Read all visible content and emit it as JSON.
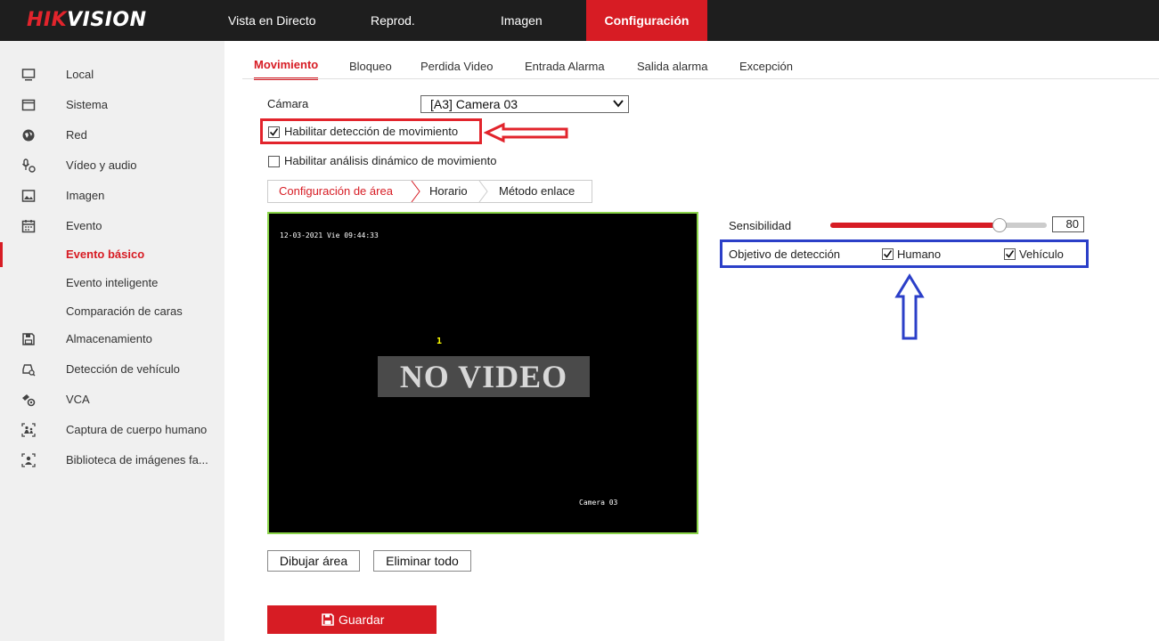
{
  "brand": {
    "logo_red": "HIK",
    "logo_white": "VISION",
    "accent": "#d71c24"
  },
  "topnav": [
    {
      "label": "Vista en Directo"
    },
    {
      "label": "Reprod."
    },
    {
      "label": "Imagen"
    },
    {
      "label": "Configuración",
      "active": true
    }
  ],
  "sidebar": {
    "items": [
      {
        "label": "Local",
        "icon": "monitor-icon"
      },
      {
        "label": "Sistema",
        "icon": "system-icon"
      },
      {
        "label": "Red",
        "icon": "globe-icon"
      },
      {
        "label": "Vídeo y audio",
        "icon": "video-audio-icon"
      },
      {
        "label": "Imagen",
        "icon": "image-icon"
      },
      {
        "label": "Evento",
        "icon": "calendar-icon"
      },
      {
        "label": "Evento básico",
        "active": true
      },
      {
        "label": "Evento inteligente"
      },
      {
        "label": "Comparación de caras"
      },
      {
        "label": "Almacenamiento",
        "icon": "storage-icon"
      },
      {
        "label": "Detección de vehículo",
        "icon": "vehicle-search-icon"
      },
      {
        "label": "VCA",
        "icon": "vca-icon"
      },
      {
        "label": "Captura de cuerpo humano",
        "icon": "body-capture-icon"
      },
      {
        "label": "Biblioteca de imágenes fa...",
        "icon": "face-library-icon"
      }
    ]
  },
  "tabs": [
    {
      "label": "Movimiento",
      "active": true
    },
    {
      "label": "Bloqueo"
    },
    {
      "label": "Perdida Video"
    },
    {
      "label": "Entrada Alarma"
    },
    {
      "label": "Salida alarma"
    },
    {
      "label": "Excepción"
    }
  ],
  "camera": {
    "label": "Cámara",
    "selected": "[A3] Camera 03"
  },
  "enable_motion": {
    "label": "Habilitar detección de movimiento",
    "checked": true
  },
  "enable_dynamic": {
    "label": "Habilitar análisis dinámico de movimiento",
    "checked": false
  },
  "subtabs": [
    {
      "label": "Configuración de área",
      "active": true
    },
    {
      "label": "Horario"
    },
    {
      "label": "Método enlace"
    }
  ],
  "video": {
    "timestamp": "12-03-2021 Vie 09:44:33",
    "marker": "1",
    "no_video": "NO VIDEO",
    "camera_name": "Camera 03"
  },
  "sensitivity": {
    "label": "Sensibilidad",
    "value": "80",
    "level": 0.8
  },
  "detection_target": {
    "label": "Objetivo de detección",
    "human": {
      "label": "Humano",
      "checked": true
    },
    "vehicle": {
      "label": "Vehículo",
      "checked": true
    }
  },
  "buttons": {
    "draw": "Dibujar área",
    "clear": "Eliminar todo",
    "save": "Guardar"
  },
  "annotation_colors": {
    "red": "#e2242c",
    "blue": "#2b3fc8",
    "video_border": "#8bd44a"
  }
}
